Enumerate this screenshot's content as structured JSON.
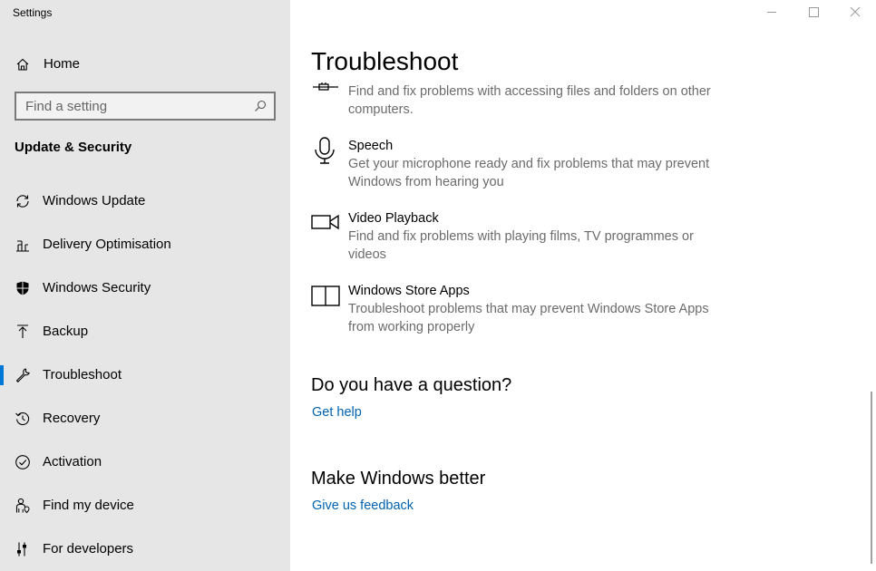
{
  "app": {
    "title": "Settings"
  },
  "sidebar": {
    "home_label": "Home",
    "search_placeholder": "Find a setting",
    "section_title": "Update & Security",
    "items": [
      {
        "label": "Windows Update",
        "icon": "sync-icon"
      },
      {
        "label": "Delivery Optimisation",
        "icon": "delivery-optimisation-icon"
      },
      {
        "label": "Windows Security",
        "icon": "shield-icon"
      },
      {
        "label": "Backup",
        "icon": "backup-arrow-icon"
      },
      {
        "label": "Troubleshoot",
        "icon": "wrench-icon",
        "selected": true
      },
      {
        "label": "Recovery",
        "icon": "recovery-icon"
      },
      {
        "label": "Activation",
        "icon": "check-circle-icon"
      },
      {
        "label": "Find my device",
        "icon": "person-location-icon"
      },
      {
        "label": "For developers",
        "icon": "developer-sliders-icon"
      }
    ]
  },
  "main": {
    "title": "Troubleshoot",
    "troubleshooters": [
      {
        "name": "",
        "description": "Find and fix problems with accessing files and folders on other computers.",
        "icon": "network-share-icon"
      },
      {
        "name": "Speech",
        "description": "Get your microphone ready and fix problems that may prevent Windows from hearing you",
        "icon": "microphone-icon"
      },
      {
        "name": "Video Playback",
        "description": "Find and fix problems with playing films, TV programmes or videos",
        "icon": "video-camera-icon"
      },
      {
        "name": "Windows Store Apps",
        "description": "Troubleshoot problems that may prevent Windows Store Apps from working properly",
        "icon": "store-app-icon"
      }
    ],
    "question": {
      "heading": "Do you have a question?",
      "link": "Get help"
    },
    "feedback": {
      "heading": "Make Windows better",
      "link": "Give us feedback"
    }
  },
  "colors": {
    "sidebar_bg": "#e6e6e6",
    "accent": "#0078d7",
    "link": "#0063b1",
    "secondary_text": "#6b6b6b"
  }
}
